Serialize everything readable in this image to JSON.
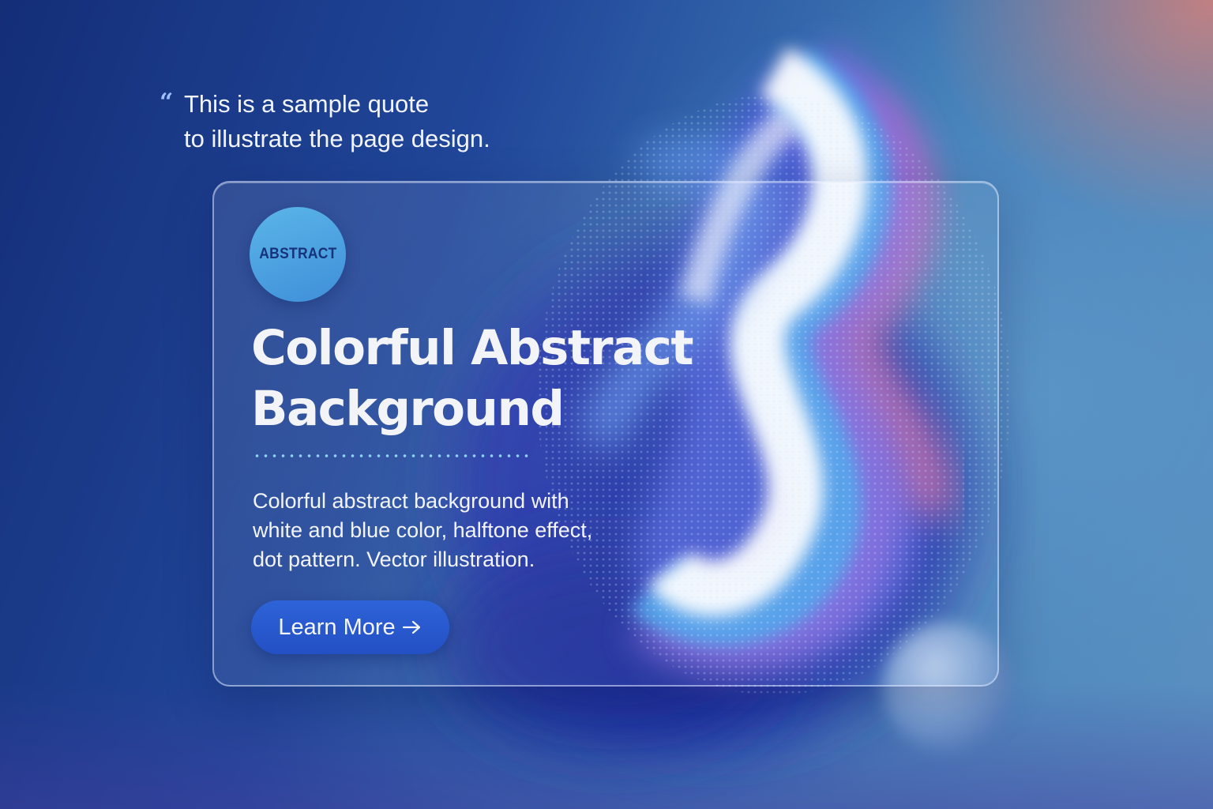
{
  "quote": {
    "text": "This is a sample quote\nto illustrate the page design."
  },
  "card": {
    "badge": "ABSTRACT",
    "title": "Colorful Abstract\nBackground",
    "description": "Colorful abstract background with\nwhite and blue color, halftone effect,\ndot pattern. Vector illustration.",
    "button_label": "Learn More"
  },
  "icons": {
    "quote": "quote-mark-icon",
    "button": "arrow-right-icon"
  },
  "colors": {
    "background_dark": "#142e78",
    "background_light": "#5a8fbf",
    "corner_accent": "#d68078",
    "badge": "#4fa3e0",
    "button": "#2a5bd0",
    "divider_dots": "#8fd3f5"
  }
}
